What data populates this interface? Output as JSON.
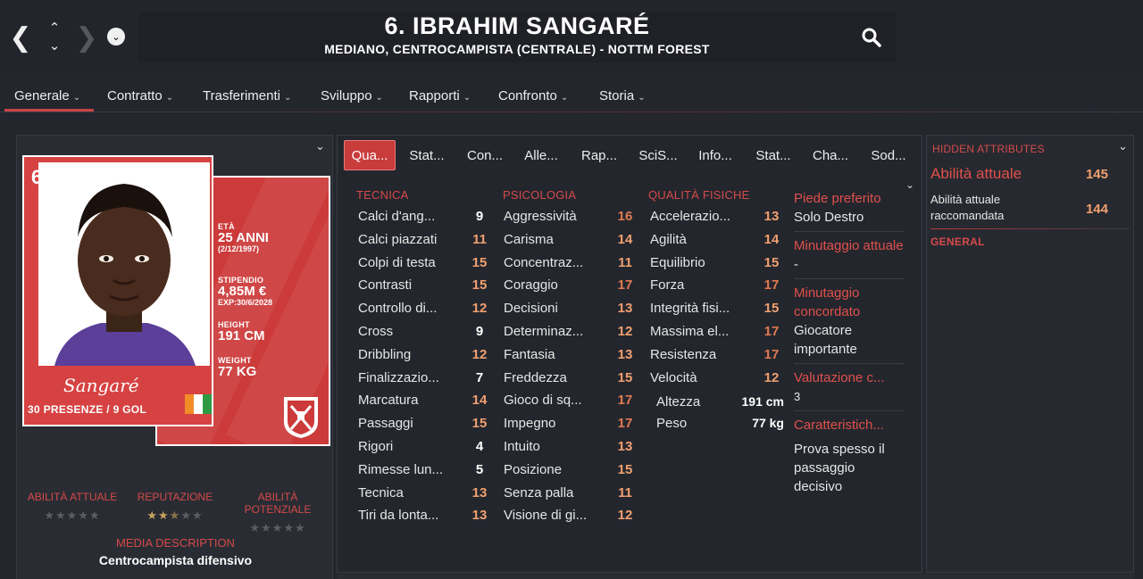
{
  "header": {
    "title": "6. IBRAHIM SANGARÉ",
    "subtitle": "MEDIANO, CENTROCAMPISTA (CENTRALE) - NOTTM FOREST",
    "icons": [
      "back-icon",
      "up-icon",
      "down-icon",
      "forward-icon",
      "menu-dot-icon",
      "search-icon"
    ]
  },
  "menu": [
    {
      "label": "Generale"
    },
    {
      "label": "Contratto"
    },
    {
      "label": "Trasferimenti"
    },
    {
      "label": "Sviluppo"
    },
    {
      "label": "Rapporti"
    },
    {
      "label": "Confronto"
    },
    {
      "label": "Storia"
    }
  ],
  "card": {
    "number": "6",
    "eta_label": "ETÀ",
    "eta_value": "25 ANNI",
    "birth": "(2/12/1997)",
    "wage_label": "STIPENDIO",
    "wage_value": "4,85M €",
    "expiry": "EXP:30/6/2028",
    "height_label": "HEIGHT",
    "height_value": "191 CM",
    "weight_label": "WEIGHT",
    "weight_value": "77 KG",
    "signature": "Sangaré",
    "apps": "30 PRESENZE / 9 GOL",
    "flag_colors": [
      "#f28c28",
      "#ffffff",
      "#2e9a44"
    ],
    "accent": "#d64242"
  },
  "ratings": {
    "current_label": "ABILITÀ ATTUALE",
    "reputation_label": "REPUTAZIONE",
    "potential_label": "ABILITÀ POTENZIALE",
    "reputation_stars": 2.5,
    "media_title": "MEDIA DESCRIPTION",
    "media_desc": "Centrocampista difensivo"
  },
  "subtabs": [
    "Qua...",
    "Stat...",
    "Con...",
    "Alle...",
    "Rap...",
    "SciS...",
    "Info...",
    "Stat...",
    "Cha...",
    "Sod..."
  ],
  "attributes": {
    "tecnica_title": "TECNICA",
    "psicologia_title": "PSICOLOGIA",
    "fisiche_title": "QUALITÀ FISICHE",
    "tecnica": [
      {
        "name": "Calci d'ang...",
        "value": "9"
      },
      {
        "name": "Calci piazzati",
        "value": "11"
      },
      {
        "name": "Colpi di testa",
        "value": "15"
      },
      {
        "name": "Contrasti",
        "value": "15"
      },
      {
        "name": "Controllo di...",
        "value": "12"
      },
      {
        "name": "Cross",
        "value": "9"
      },
      {
        "name": "Dribbling",
        "value": "12"
      },
      {
        "name": "Finalizzazio...",
        "value": "7"
      },
      {
        "name": "Marcatura",
        "value": "14"
      },
      {
        "name": "Passaggi",
        "value": "15"
      },
      {
        "name": "Rigori",
        "value": "4"
      },
      {
        "name": "Rimesse lun...",
        "value": "5"
      },
      {
        "name": "Tecnica",
        "value": "13"
      },
      {
        "name": "Tiri da lonta...",
        "value": "13"
      }
    ],
    "psicologia": [
      {
        "name": "Aggressività",
        "value": "16"
      },
      {
        "name": "Carisma",
        "value": "14"
      },
      {
        "name": "Concentraz...",
        "value": "11"
      },
      {
        "name": "Coraggio",
        "value": "17"
      },
      {
        "name": "Decisioni",
        "value": "13"
      },
      {
        "name": "Determinaz...",
        "value": "12"
      },
      {
        "name": "Fantasia",
        "value": "13"
      },
      {
        "name": "Freddezza",
        "value": "15"
      },
      {
        "name": "Gioco di sq...",
        "value": "17"
      },
      {
        "name": "Impegno",
        "value": "17"
      },
      {
        "name": "Intuito",
        "value": "13"
      },
      {
        "name": "Posizione",
        "value": "15"
      },
      {
        "name": "Senza palla",
        "value": "11"
      },
      {
        "name": "Visione di gi...",
        "value": "12"
      }
    ],
    "fisiche": [
      {
        "name": "Accelerazio...",
        "value": "13"
      },
      {
        "name": "Agilità",
        "value": "14"
      },
      {
        "name": "Equilibrio",
        "value": "15"
      },
      {
        "name": "Forza",
        "value": "17"
      },
      {
        "name": "Integrità fisi...",
        "value": "15"
      },
      {
        "name": "Massima el...",
        "value": "17"
      },
      {
        "name": "Resistenza",
        "value": "17"
      },
      {
        "name": "Velocità",
        "value": "12"
      }
    ],
    "altezza_label": "Altezza",
    "altezza_value": "191 cm",
    "peso_label": "Peso",
    "peso_value": "77 kg"
  },
  "side_info": {
    "piede_label": "Piede preferito",
    "piede_value": "Solo Destro",
    "minutaggio_label": "Minutaggio attuale",
    "minutaggio_value": "-",
    "concordato_label": "Minutaggio concordato",
    "concordato_value": "Giocatore importante",
    "valutazione_label": "Valutazione c...",
    "valutazione_value": "3",
    "caratteristiche_label": "Caratteristich...",
    "caratteristiche_value": "Prova spesso il passaggio decisivo"
  },
  "hidden": {
    "title": "HIDDEN ATTRIBUTES",
    "current_label": "Abilità attuale",
    "current_value": "145",
    "recommended_label": "Abilità attuale raccomandata",
    "recommended_value": "144",
    "general_title": "GENERAL"
  },
  "colors": {
    "accent_red": "#d44a4a",
    "value_orange": "#f0a070",
    "background": "#24262e"
  }
}
